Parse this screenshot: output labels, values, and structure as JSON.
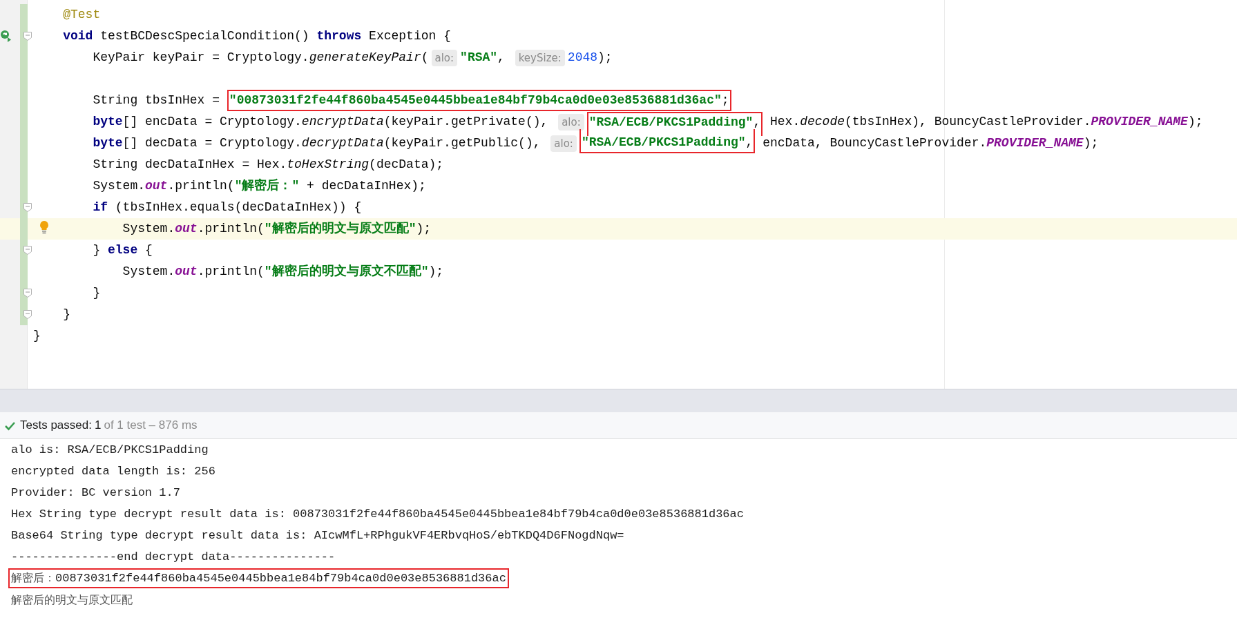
{
  "editor": {
    "body": [
      {
        "changed": true,
        "current": false,
        "tokens": [
          {
            "kind": "annotation",
            "text": "@Test"
          }
        ]
      },
      {
        "changed": true,
        "current": false,
        "markers": [
          {
            "kind": "run"
          },
          {
            "kind": "fold"
          }
        ],
        "tokens": [
          {
            "kind": "keyword",
            "text": "void"
          },
          {
            "kind": "plain",
            "text": " testBCDescSpecialCondition() "
          },
          {
            "kind": "keyword",
            "text": "throws"
          },
          {
            "kind": "plain",
            "text": " Exception {"
          }
        ],
        "children": [
          {
            "changed": true,
            "current": false,
            "tokens": [
              {
                "kind": "plain",
                "text": "KeyPair keyPair = Cryptology."
              },
              {
                "kind": "method",
                "text": "generateKeyPair"
              },
              {
                "kind": "plain",
                "text": "("
              },
              {
                "kind": "hint",
                "text": "alo:"
              },
              {
                "kind": "string",
                "text": "\"RSA\""
              },
              {
                "kind": "plain",
                "text": ", "
              },
              {
                "kind": "hint",
                "text": "keySize:"
              },
              {
                "kind": "number",
                "text": "2048"
              },
              {
                "kind": "plain",
                "text": ");"
              }
            ]
          },
          {
            "changed": true,
            "current": false
          },
          {
            "changed": true,
            "current": false,
            "tokens": [
              {
                "kind": "plain",
                "text": "String tbsInHex = "
              },
              {
                "kind": "boxed",
                "tokens": [
                  {
                    "kind": "string",
                    "text": "\"00873031f2fe44f860ba4545e0445bbea1e84bf79b4ca0d0e03e8536881d36ac\""
                  },
                  {
                    "kind": "plain",
                    "text": ";"
                  }
                ]
              }
            ]
          },
          {
            "changed": true,
            "current": false,
            "tokens": [
              {
                "kind": "keyword",
                "text": "byte"
              },
              {
                "kind": "plain",
                "text": "[] encData = Cryptology."
              },
              {
                "kind": "method",
                "text": "encryptData"
              },
              {
                "kind": "plain",
                "text": "(keyPair.getPrivate(), "
              },
              {
                "kind": "hint",
                "text": "alo:"
              },
              {
                "kind": "boxed_top",
                "tokens": [
                  {
                    "kind": "string",
                    "text": "\"RSA/ECB/PKCS1Padding\""
                  },
                  {
                    "kind": "plain",
                    "text": ","
                  }
                ]
              },
              {
                "kind": "plain",
                "text": " Hex."
              },
              {
                "kind": "method",
                "text": "decode"
              },
              {
                "kind": "plain",
                "text": "(tbsInHex), BouncyCastleProvider."
              },
              {
                "kind": "static",
                "text": "PROVIDER_NAME"
              },
              {
                "kind": "plain",
                "text": ");"
              }
            ]
          },
          {
            "changed": true,
            "current": false,
            "tokens": [
              {
                "kind": "keyword",
                "text": "byte"
              },
              {
                "kind": "plain",
                "text": "[] decData = Cryptology."
              },
              {
                "kind": "method",
                "text": "decryptData"
              },
              {
                "kind": "plain",
                "text": "(keyPair.getPublic(), "
              },
              {
                "kind": "hint",
                "text": "alo:"
              },
              {
                "kind": "boxed_bottom",
                "tokens": [
                  {
                    "kind": "string",
                    "text": "\"RSA/ECB/PKCS1Padding\""
                  },
                  {
                    "kind": "plain",
                    "text": ","
                  }
                ]
              },
              {
                "kind": "plain",
                "text": " encData, BouncyCastleProvider."
              },
              {
                "kind": "static",
                "text": "PROVIDER_NAME"
              },
              {
                "kind": "plain",
                "text": ");"
              }
            ]
          },
          {
            "changed": true,
            "current": false,
            "tokens": [
              {
                "kind": "plain",
                "text": "String decDataInHex = Hex."
              },
              {
                "kind": "method",
                "text": "toHexString"
              },
              {
                "kind": "plain",
                "text": "(decData);"
              }
            ]
          },
          {
            "changed": true,
            "current": false,
            "tokens": [
              {
                "kind": "plain",
                "text": "System."
              },
              {
                "kind": "static",
                "text": "out"
              },
              {
                "kind": "plain",
                "text": ".println("
              },
              {
                "kind": "string",
                "text": "\"解密后：\""
              },
              {
                "kind": "plain",
                "text": " + decDataInHex);"
              }
            ]
          },
          {
            "changed": true,
            "current": false,
            "markers": [
              {
                "kind": "fold"
              }
            ],
            "tokens": [
              {
                "kind": "keyword",
                "text": "if"
              },
              {
                "kind": "plain",
                "text": " (tbsInHex.equals(decDataInHex)) {"
              }
            ],
            "children": [
              {
                "changed": true,
                "current": true,
                "markers": [
                  {
                    "kind": "bulb"
                  }
                ],
                "tokens": [
                  {
                    "kind": "plain",
                    "text": "System."
                  },
                  {
                    "kind": "static",
                    "text": "out"
                  },
                  {
                    "kind": "plain",
                    "text": ".println("
                  },
                  {
                    "kind": "string",
                    "text": "\"解密后的明文与原文匹配\""
                  },
                  {
                    "kind": "plain",
                    "text": ");"
                  }
                ]
              }
            ]
          },
          {
            "changed": true,
            "current": false,
            "markers": [
              {
                "kind": "fold"
              }
            ],
            "tokens": [
              {
                "kind": "plain",
                "text": "} "
              },
              {
                "kind": "keyword",
                "text": "else"
              },
              {
                "kind": "plain",
                "text": " {"
              }
            ],
            "children": [
              {
                "changed": true,
                "current": false,
                "tokens": [
                  {
                    "kind": "plain",
                    "text": "System."
                  },
                  {
                    "kind": "static",
                    "text": "out"
                  },
                  {
                    "kind": "plain",
                    "text": ".println("
                  },
                  {
                    "kind": "string",
                    "text": "\"解密后的明文与原文不匹配\""
                  },
                  {
                    "kind": "plain",
                    "text": ");"
                  }
                ]
              }
            ]
          },
          {
            "changed": true,
            "current": false,
            "markers": [
              {
                "kind": "fold"
              }
            ],
            "tokens": [
              {
                "kind": "plain",
                "text": "}"
              }
            ]
          }
        ]
      },
      {
        "changed": true,
        "current": false,
        "markers": [
          {
            "kind": "fold"
          }
        ],
        "tokens": [
          {
            "kind": "plain",
            "text": "}"
          }
        ]
      }
    ],
    "closing": {
      "changed": false,
      "current": false,
      "tokens": [
        {
          "kind": "plain",
          "text": "}"
        }
      ]
    }
  },
  "test_status": {
    "passed": true,
    "label": "Tests passed:",
    "count": "1",
    "detail": "of 1 test – 876 ms"
  },
  "console": {
    "lines": [
      {
        "kind": "plain",
        "segments": [
          {
            "kind": "mono",
            "text": "alo is: RSA/ECB/PKCS1Padding"
          }
        ]
      },
      {
        "kind": "plain",
        "segments": [
          {
            "kind": "mono",
            "text": "encrypted data length is: 256"
          }
        ]
      },
      {
        "kind": "plain",
        "segments": [
          {
            "kind": "mono",
            "text": "Provider: BC version 1.7"
          }
        ]
      },
      {
        "kind": "plain",
        "segments": [
          {
            "kind": "mono",
            "text": "Hex String type decrypt result data is: 00873031f2fe44f860ba4545e0445bbea1e84bf79b4ca0d0e03e8536881d36ac"
          }
        ]
      },
      {
        "kind": "plain",
        "segments": [
          {
            "kind": "mono",
            "text": "Base64 String type decrypt result data is: AIcwMfL+RPhgukVF4ERbvqHoS/ebTKDQ4D6FNogdNqw="
          }
        ]
      },
      {
        "kind": "plain",
        "segments": [
          {
            "kind": "mono",
            "text": "---------------end decrypt data---------------"
          }
        ]
      },
      {
        "kind": "boxed",
        "segments": [
          {
            "kind": "cjk",
            "text": "解密后："
          },
          {
            "kind": "mono",
            "text": "00873031f2fe44f860ba4545e0445bbea1e84bf79b4ca0d0e03e8536881d36ac"
          }
        ]
      },
      {
        "kind": "plain",
        "segments": [
          {
            "kind": "cjk",
            "text": "解密后的明文与原文匹配"
          }
        ]
      }
    ]
  }
}
